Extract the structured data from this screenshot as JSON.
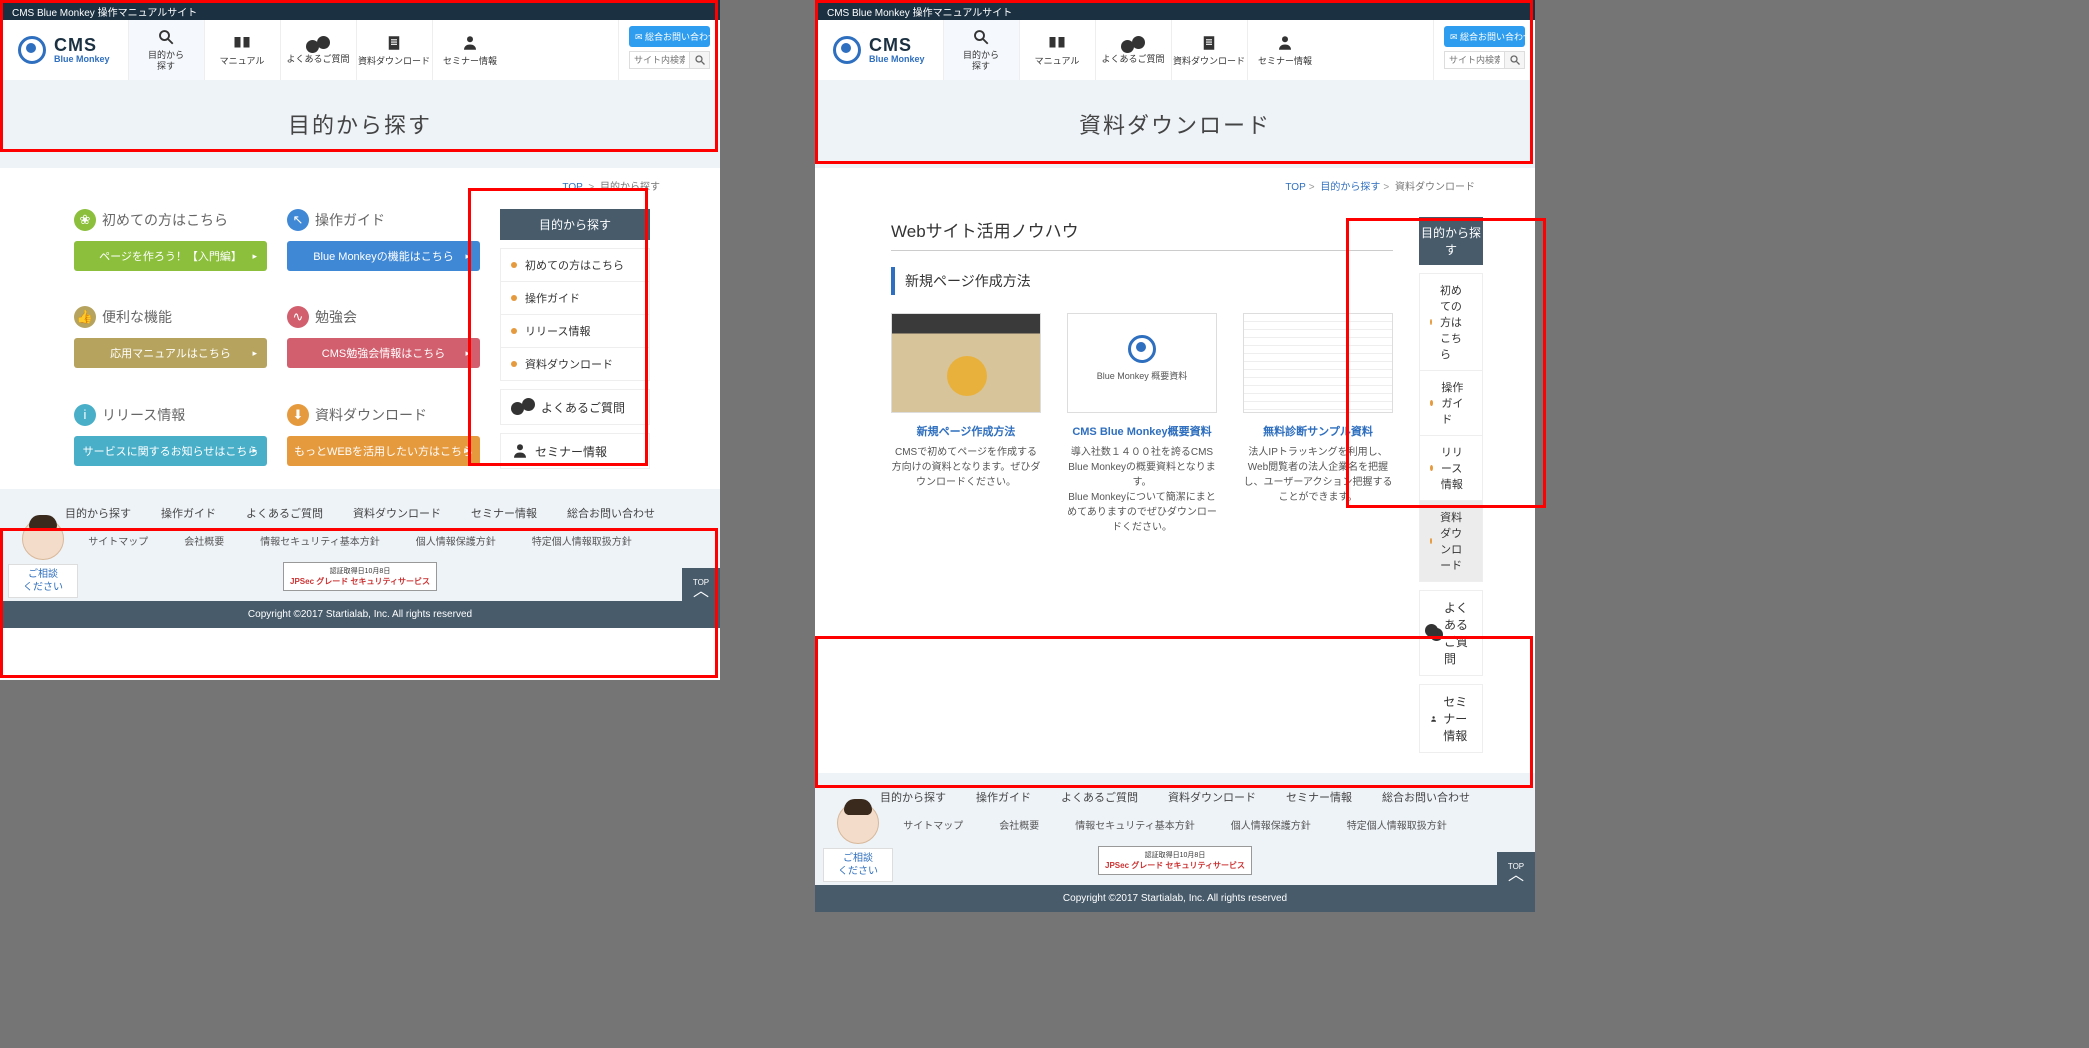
{
  "topbar": "CMS Blue Monkey 操作マニュアルサイト",
  "logo": {
    "big": "CMS",
    "sub": "Blue Monkey"
  },
  "nav": [
    {
      "label": "目的から\n探す"
    },
    {
      "label": "マニュアル"
    },
    {
      "label": "よくあるご質問"
    },
    {
      "label": "資料ダウンロード"
    },
    {
      "label": "セミナー情報"
    }
  ],
  "contact": "✉ 総合お問い合わせ",
  "search_placeholder": "サイト内検索",
  "left": {
    "hero": "目的から探す",
    "crumb_top": "TOP",
    "crumb_cur": "目的から探す",
    "cards": [
      {
        "title": "初めての方はこちら",
        "btn": "ページを作ろう！【入門編】"
      },
      {
        "title": "操作ガイド",
        "btn": "Blue Monkeyの機能はこちら"
      },
      {
        "title": "便利な機能",
        "btn": "応用マニュアルはこちら"
      },
      {
        "title": "勉強会",
        "btn": "CMS勉強会情報はこちら"
      },
      {
        "title": "リリース情報",
        "btn": "サービスに関するお知らせはこちら"
      },
      {
        "title": "資料ダウンロード",
        "btn": "もっとWEBを活用したい方はこちら"
      }
    ],
    "sidebar_title": "目的から探す",
    "sidebar_items": [
      "初めての方はこちら",
      "操作ガイド",
      "リリース情報",
      "資料ダウンロード"
    ],
    "sidebar_links": [
      "よくあるご質問",
      "セミナー情報"
    ]
  },
  "right": {
    "hero": "資料ダウンロード",
    "crumb_top": "TOP",
    "crumb_mid": "目的から探す",
    "crumb_cur": "資料ダウンロード",
    "section": "Webサイト活用ノウハウ",
    "subsection": "新規ページ作成方法",
    "docs": [
      {
        "title": "新規ページ作成方法",
        "desc": "CMSで初めてページを作成する方向けの資料となります。ぜひダウンロードください。"
      },
      {
        "title": "CMS Blue Monkey概要資料",
        "desc": "導入社数１４００社を誇るCMS Blue Monkeyの概要資料となります。\nBlue Monkeyについて簡潔にまとめてありますのでぜひダウンロードください。"
      },
      {
        "title": "無料診断サンプル資料",
        "desc": "法人IPトラッキングを利用し、Web閲覧者の法人企業名を把握し、ユーザーアクション把握することができます。"
      }
    ],
    "thumb2_caption": "Blue Monkey 概要資料",
    "sidebar_title": "目的から探す",
    "sidebar_items": [
      "初めての方はこちら",
      "操作ガイド",
      "リリース情報",
      "資料ダウンロード"
    ],
    "sidebar_links": [
      "よくあるご質問",
      "セミナー情報"
    ],
    "sidebar_active_index": 3
  },
  "footer": {
    "row1": [
      "目的から探す",
      "操作ガイド",
      "よくあるご質問",
      "資料ダウンロード",
      "セミナー情報",
      "総合お問い合わせ"
    ],
    "row2": [
      "サイトマップ",
      "会社概要",
      "情報セキュリティ基本方針",
      "個人情報保護方針",
      "特定個人情報取扱方針"
    ],
    "badge_top": "認証取得日10月8日",
    "badge_bot": "JPSec グレード セキュリティサービス",
    "copyright": "Copyright ©2017 Startialab, Inc. All rights reserved",
    "consult": "ご相談\nください",
    "top": "TOP"
  }
}
